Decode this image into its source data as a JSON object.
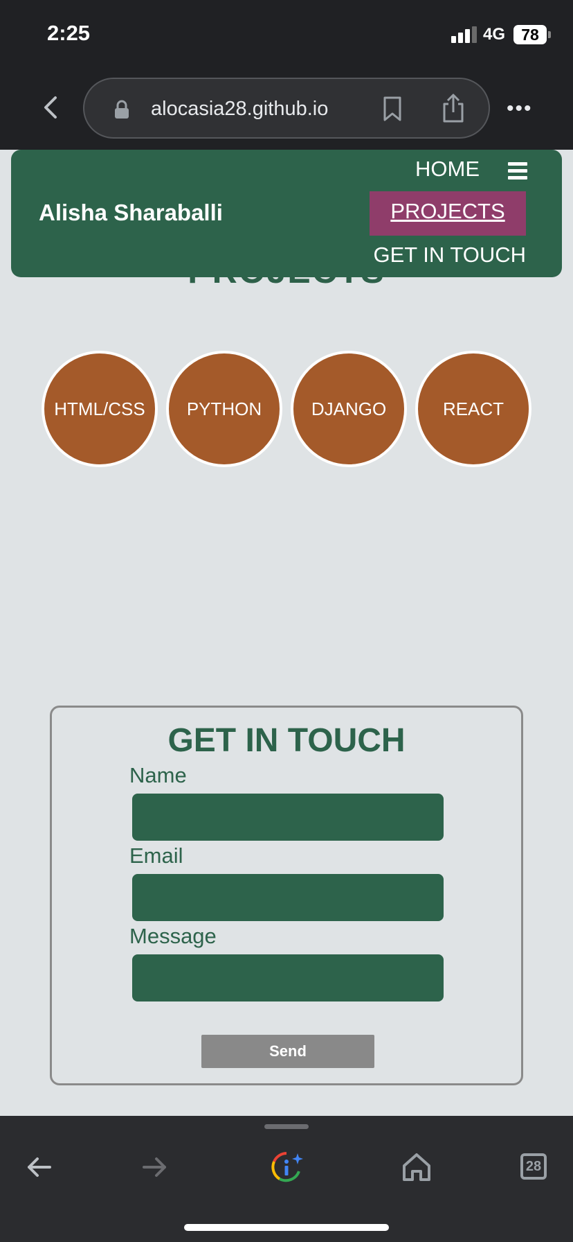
{
  "status_bar": {
    "time": "2:25",
    "network": "4G",
    "battery": "78"
  },
  "browser": {
    "url": "alocasia28.github.io",
    "tabs_count": "28",
    "icons": [
      "back-chevron-icon",
      "lock-icon",
      "bookmark-icon",
      "share-icon",
      "more-icon",
      "back-arrow-icon",
      "forward-arrow-icon",
      "google-lens-icon",
      "home-icon",
      "tabs-icon"
    ]
  },
  "site": {
    "brand": "Alisha Sharaballi",
    "nav": {
      "home": "HOME",
      "projects": "PROJECTS",
      "contact": "GET IN TOUCH"
    },
    "projects_heading": "PROJECTS",
    "skills": [
      "HTML/CSS",
      "PYTHON",
      "DJANGO",
      "REACT"
    ],
    "contact": {
      "title": "GET IN TOUCH",
      "name_label": "Name",
      "email_label": "Email",
      "message_label": "Message",
      "send_label": "Send"
    }
  },
  "colors": {
    "primary_green": "#2d634b",
    "active_nav": "#8f3d6a",
    "skill_circle": "#a45a2a",
    "page_bg": "#dfe3e5"
  }
}
